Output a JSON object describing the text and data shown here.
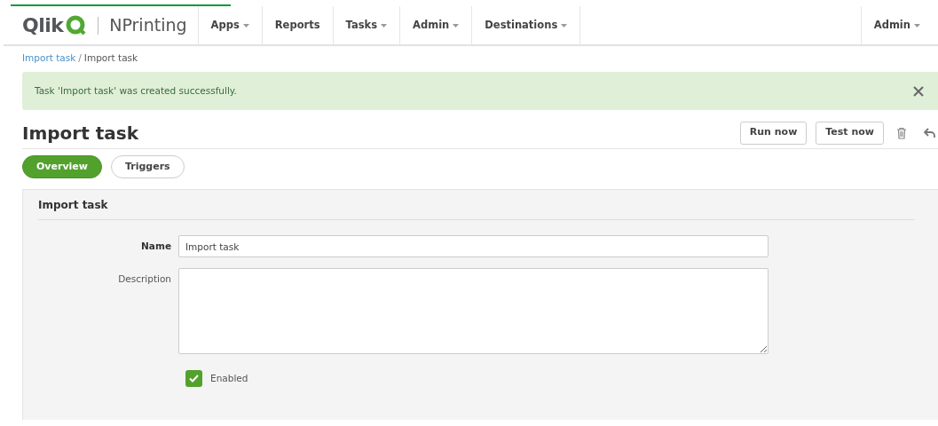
{
  "brand": {
    "logo": "Qlik",
    "product": "NPrinting"
  },
  "nav": [
    {
      "label": "Apps",
      "dropdown": true
    },
    {
      "label": "Reports",
      "dropdown": false
    },
    {
      "label": "Tasks",
      "dropdown": true
    },
    {
      "label": "Admin",
      "dropdown": true
    },
    {
      "label": "Destinations",
      "dropdown": true
    }
  ],
  "user_menu": {
    "label": "Admin",
    "dropdown": true
  },
  "breadcrumb": [
    {
      "label": "Import task",
      "link": true
    },
    {
      "label": "Import task",
      "link": false
    }
  ],
  "breadcrumb_separator": "/",
  "alert": {
    "message": "Task 'Import task' was created successfully."
  },
  "page_title": "Import task",
  "actions": [
    "Run now",
    "Test now"
  ],
  "tabs": [
    {
      "label": "Overview",
      "selected": true
    },
    {
      "label": "Triggers",
      "selected": false
    }
  ],
  "panel": {
    "title": "Import task",
    "fields": [
      {
        "kind": "text",
        "label": "Name",
        "value": "Import task",
        "bold": true
      },
      {
        "kind": "textarea",
        "label": "Description",
        "bold": false
      }
    ],
    "enabled": {
      "label": "Enabled",
      "checked": true
    }
  }
}
